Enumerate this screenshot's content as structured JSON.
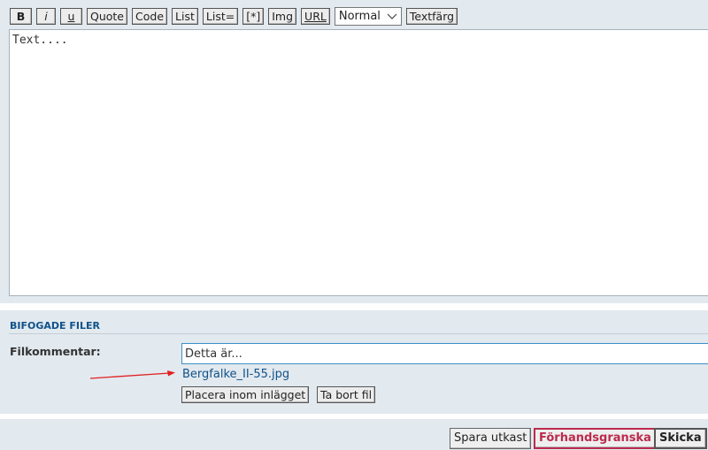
{
  "toolbar": {
    "bold": "B",
    "italic": "i",
    "underline": "u",
    "quote": "Quote",
    "code": "Code",
    "list": "List",
    "list_ordered": "List=",
    "list_item": "[*]",
    "img": "Img",
    "url": "URL",
    "font_size_selected": "Normal",
    "font_color": "Textfärg"
  },
  "editor": {
    "content": "Text...."
  },
  "attachments": {
    "title": "BIFOGADE FILER",
    "comment_label": "Filkommentar:",
    "comment_value": "Detta är...",
    "file_name": "Bergfalke_II-55.jpg",
    "place_inline_label": "Placera inom inlägget",
    "delete_file_label": "Ta bort fil",
    "annotation_arrow_color": "#e02020"
  },
  "actions": {
    "save_draft": "Spara utkast",
    "preview": "Förhandsgranska",
    "submit": "Skicka"
  }
}
